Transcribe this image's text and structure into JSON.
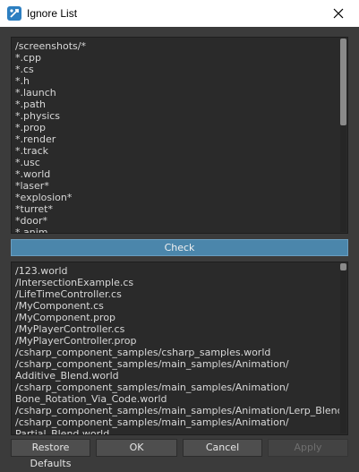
{
  "window": {
    "title": "Ignore List",
    "close_icon": "close-icon",
    "app_icon": "app-icon",
    "colors": {
      "accent": "#4b86ab",
      "background": "#3b3b3b",
      "panel": "#2a2a2a"
    }
  },
  "ignore_list": {
    "items": [
      "/screenshots/*",
      "*.cpp",
      "*.cs",
      "*.h",
      "*.launch",
      "*.path",
      "*.physics",
      "*.prop",
      "*.render",
      "*.track",
      "*.usc",
      "*.world",
      "*laser*",
      "*explosion*",
      "*turret*",
      "*door*",
      "*.anim"
    ],
    "scroll_fraction": 0.45
  },
  "check_button": {
    "label": "Check"
  },
  "results_list": {
    "items": [
      "/123.world",
      "/IntersectionExample.cs",
      "/LifeTimeController.cs",
      "/MyComponent.cs",
      "/MyComponent.prop",
      "/MyPlayerController.cs",
      "/MyPlayerController.prop",
      "/csharp_component_samples/csharp_samples.world",
      "/csharp_component_samples/main_samples/Animation/",
      "Additive_Blend.world",
      "/csharp_component_samples/main_samples/Animation/",
      "Bone_Rotation_Via_Code.world",
      "/csharp_component_samples/main_samples/Animation/Lerp_Blend.world",
      "/csharp_component_samples/main_samples/Animation/",
      "Partial_Blend.world"
    ],
    "scroll_fraction": 0.04
  },
  "footer": {
    "restore_label": "Restore Defaults",
    "ok_label": "OK",
    "cancel_label": "Cancel",
    "apply_label": "Apply"
  }
}
